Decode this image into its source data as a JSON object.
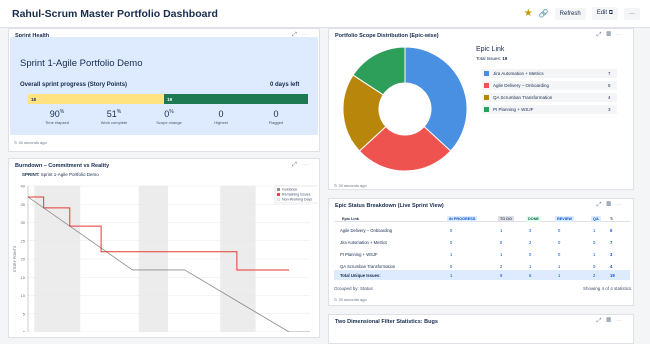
{
  "header": {
    "title": "Rahul-Scrum Master Portfolio Dashboard",
    "refresh_label": "Refresh",
    "edit_label": "Edit",
    "more_label": "···"
  },
  "sprint_health": {
    "title": "Sprint Health",
    "sprint_name": "Sprint 1-Agile Portfolio Demo",
    "progress_label": "Overall sprint progress (Story Points)",
    "days_left": "0 days left",
    "done_points": "18",
    "todo_points": "19",
    "done_fraction": 0.486,
    "stats": [
      {
        "value": "90",
        "unit": "%",
        "label": "Time elapsed"
      },
      {
        "value": "51",
        "unit": "%",
        "label": "Work complete"
      },
      {
        "value": "0",
        "unit": "%",
        "label": "Scope change"
      },
      {
        "value": "0",
        "unit": "",
        "label": "Highest"
      },
      {
        "value": "0",
        "unit": "",
        "label": "Flagged"
      }
    ],
    "footer": "30 seconds ago"
  },
  "burndown": {
    "title": "Burndown – Commitment vs Reality",
    "sprint_prefix": "SPRINT:",
    "sprint_name": "Sprint 1-Agile Portfolio Demo",
    "ylabel": "STORY POINTS",
    "legend": [
      "Guidance",
      "Remaining Issues",
      "Non-Working Days"
    ]
  },
  "scope": {
    "title": "Portfolio Scope Distribution (Epic-wise)",
    "legend_title": "Epic Link",
    "total_label": "Total Issues:",
    "total": "19",
    "footer": "30 seconds ago"
  },
  "epic_status": {
    "title": "Epic Status Breakdown (Live Sprint View)",
    "columns": [
      "Epic Link",
      "IN PROGRESS",
      "TO DO",
      "DONE",
      "REVIEW",
      "QA",
      "T:"
    ],
    "rows": [
      {
        "name": "Agile Delivery – Onboarding",
        "values": [
          "0",
          "1",
          "3",
          "0",
          "1",
          "5"
        ]
      },
      {
        "name": "Jira Automation + Metrics",
        "values": [
          "0",
          "5",
          "2",
          "0",
          "0",
          "7"
        ]
      },
      {
        "name": "PI Planning + WSJF",
        "values": [
          "1",
          "1",
          "0",
          "0",
          "1",
          "3"
        ]
      },
      {
        "name": "QA Scrumban Transformation",
        "values": [
          "0",
          "2",
          "1",
          "1",
          "0",
          "4"
        ]
      }
    ],
    "total_row": {
      "name": "Total Unique Issues:",
      "values": [
        "1",
        "9",
        "6",
        "1",
        "2",
        "19"
      ]
    },
    "grouped_by": "Grouped by: Status",
    "showing": "Showing 4 of 4 statistics.",
    "footer": "30 seconds ago"
  },
  "filter_stats": {
    "title": "Two Dimensional Filter Statistics: Bugs"
  },
  "chart_data": [
    {
      "type": "pie",
      "title": "",
      "categories": [
        "Jira Automation + Metrics",
        "Agile Delivery – Onboarding",
        "QA Scrumban Transformation",
        "PI Planning + WSJF"
      ],
      "values": [
        7,
        5,
        4,
        3
      ],
      "colors": [
        "#4a90e2",
        "#ef5350",
        "#b8860b",
        "#2e9e5b"
      ],
      "donut": true
    },
    {
      "type": "line",
      "title": "Sprint 1-Agile Portfolio Demo",
      "ylabel": "STORY POINTS",
      "ylim": [
        0,
        40
      ],
      "yticks": [
        0,
        5,
        10,
        15,
        20,
        25,
        30,
        35,
        40
      ],
      "series": [
        {
          "name": "Guidance",
          "color": "#8c8c8c",
          "x": [
            0,
            10,
            15,
            25,
            27
          ],
          "y": [
            37,
            17,
            17,
            0,
            0
          ]
        },
        {
          "name": "Remaining Issues",
          "color": "#e53935",
          "x": [
            0,
            1.5,
            1.5,
            4,
            4,
            7,
            7,
            20,
            20,
            25
          ],
          "y": [
            37,
            37,
            34,
            34,
            29,
            29,
            22,
            22,
            17,
            17
          ]
        }
      ],
      "x_domain": [
        0,
        27
      ],
      "non_working_bands": [
        [
          0.6,
          5
        ],
        [
          10.6,
          13.4
        ],
        [
          18.4,
          21.8
        ]
      ]
    }
  ]
}
